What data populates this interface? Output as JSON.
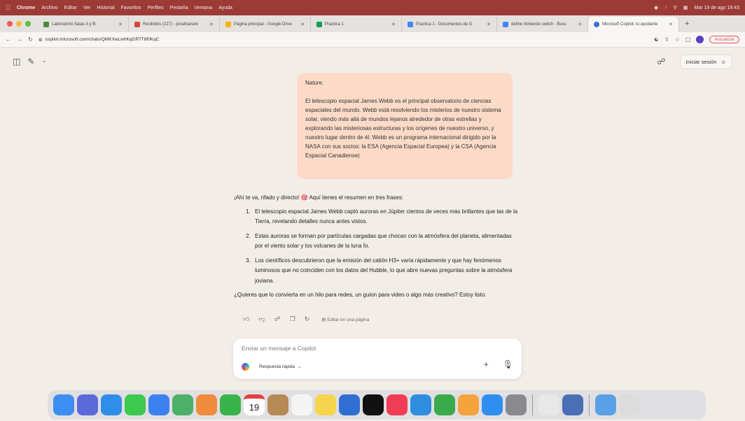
{
  "menubar": {
    "app": "Chrome",
    "items": [
      "Archivo",
      "Editar",
      "Ver",
      "Historial",
      "Favoritos",
      "Perfiles",
      "Pestaña",
      "Ventana",
      "Ayuda"
    ],
    "datetime": "Mar 19 de ago 18:43"
  },
  "tabs": [
    {
      "label": "Laboratorio Salas A y B",
      "color": "#4a8a3a"
    },
    {
      "label": "Recibidos (227) - jonathanare",
      "color": "#d44638"
    },
    {
      "label": "Página principal - Google Drive",
      "color": "#f4b400"
    },
    {
      "label": "Practica 1",
      "color": "#0f9d58"
    },
    {
      "label": "Practica 1 - Documentos de G",
      "color": "#4285f4"
    },
    {
      "label": "define Nintendo switch - Busc",
      "color": "#4285f4"
    },
    {
      "label": "Microsoft Copilot: tu ayudante",
      "color": "#3d6fd9"
    }
  ],
  "address": {
    "url": "copilot.microsoft.com/chats/QMKXwLwhKqGR7T8f0KqC",
    "update_label": "Actualizar"
  },
  "header": {
    "signin_label": "Iniciar sesión"
  },
  "user_message": {
    "line0": "Nature.",
    "paragraph": "El telescopio espacial James Webb es el principal observatorio de ciencias espaciales del mundo. Webb está resolviendo los misterios de nuestro sistema solar, viendo más allá de mundos lejanos alrededor de otras estrellas y explorando las misteriosas estructuras y los orígenes de nuestro universo, y nuestro lugar dentro de él. Webb es un programa internacional dirigido por la NASA con sus socios: la ESA (Agencia Espacial Europea) y la CSA (Agencia Espacial Canadiense)"
  },
  "reply": {
    "intro": "¡Ahí te va, rifado y directo! 🎯 Aquí tienes el resumen en tres frases:",
    "items": [
      "El telescopio espacial James Webb captó auroras en Júpiter cientos de veces más brillantes que las de la Tierra, revelando detalles nunca antes vistos.",
      "Estas auroras se forman por partículas cargadas que chocan con la atmósfera del planeta, alimentadas por el viento solar y los volcanes de la luna Ío.",
      "Los científicos descubrieron que la emisión del catión H3+ varía rápidamente y que hay fenómenos luminosos que no coinciden con los datos del Hubble, lo que abre nuevas preguntas sobre la atmósfera joviana."
    ],
    "follow_up": "¿Quieres que lo convierta en un hilo para redes, un guion para video o algo más creativo? Estoy listo."
  },
  "actions": {
    "edit_label": "Editar en una página"
  },
  "composer": {
    "placeholder": "Enviar un mensaje a Copilot",
    "mode_label": "Respuesta rápida"
  },
  "dock": {
    "calendar_day": "19",
    "apps": [
      {
        "name": "finder",
        "color": "#3d8ef0"
      },
      {
        "name": "launchpad",
        "color": "#5b6ad8"
      },
      {
        "name": "safari",
        "color": "#2f8fe8"
      },
      {
        "name": "messages",
        "color": "#3cc94e"
      },
      {
        "name": "mail",
        "color": "#3b82f0"
      },
      {
        "name": "maps",
        "color": "#4caf6a"
      },
      {
        "name": "photos",
        "color": "#f08a3c"
      },
      {
        "name": "facetime",
        "color": "#38b34a"
      },
      {
        "name": "calendar",
        "color": "#ffffff"
      },
      {
        "name": "contacts",
        "color": "#b58a55"
      },
      {
        "name": "reminders",
        "color": "#f4f4f4"
      },
      {
        "name": "notes",
        "color": "#f6d44c"
      },
      {
        "name": "freeform",
        "color": "#2f6fd1"
      },
      {
        "name": "tv",
        "color": "#111111"
      },
      {
        "name": "music",
        "color": "#f03c55"
      },
      {
        "name": "keynote",
        "color": "#2f8de0"
      },
      {
        "name": "numbers",
        "color": "#3aaa4a"
      },
      {
        "name": "pages",
        "color": "#f5a33c"
      },
      {
        "name": "app-store",
        "color": "#2f8ff0"
      },
      {
        "name": "settings",
        "color": "#8a8a8e"
      },
      {
        "name": "chrome",
        "color": "#e8e8e8"
      },
      {
        "name": "preview",
        "color": "#4a6fb5"
      },
      {
        "name": "downloads",
        "color": "#5aa0e6"
      },
      {
        "name": "trash",
        "color": "#dcdcdc"
      }
    ]
  }
}
